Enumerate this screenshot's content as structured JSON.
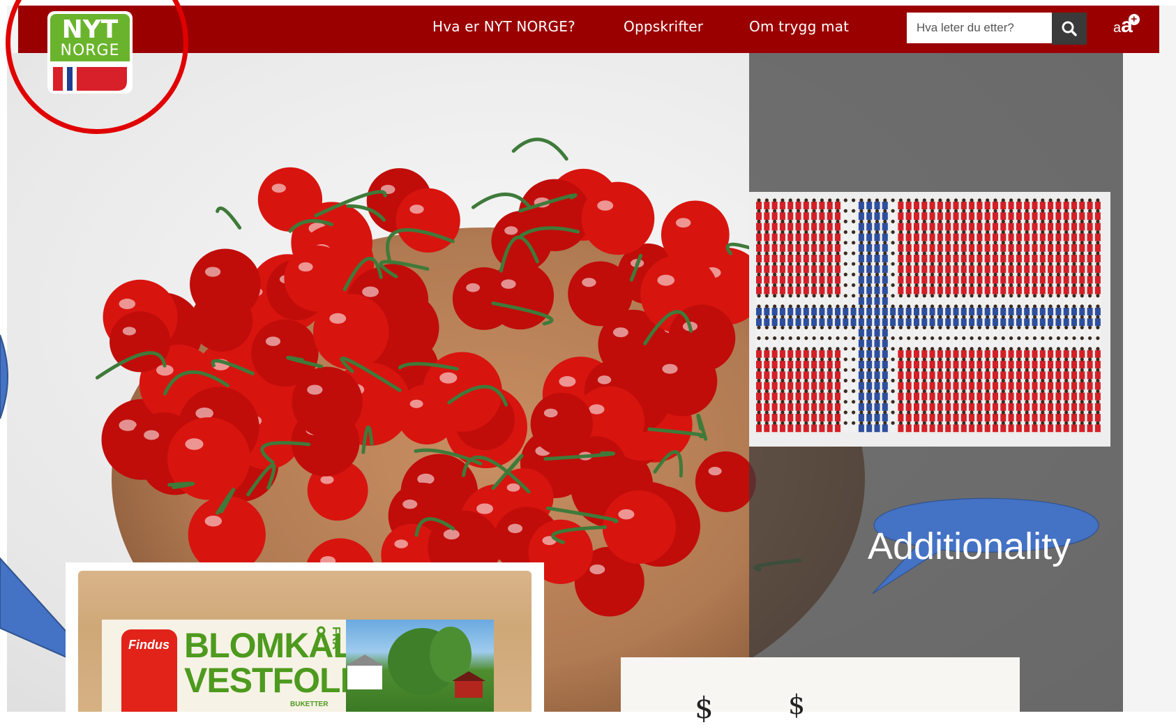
{
  "nav": {
    "links": [
      "Hva er NYT NORGE?",
      "Oppskrifter",
      "Om trygg mat"
    ],
    "search_placeholder": "Hva leter du etter?",
    "font_toggle_small": "a",
    "font_toggle_large": "a",
    "font_toggle_plus": "+"
  },
  "logo": {
    "line1": "NYT",
    "line2": "NORGE"
  },
  "product": {
    "brand": "Findus",
    "line1": "BLOMKÅL",
    "line2": "VESTFOLD",
    "fra": "FRA",
    "sub": "BUKETTER"
  },
  "callout": {
    "text": "Additionality"
  },
  "note": {
    "symbol1": "$",
    "symbol2": "$"
  },
  "colors": {
    "navbar": "#9b0000",
    "logo_green": "#6ab42d",
    "highlight_circle": "#e00000",
    "bubble_fill": "#4472c4",
    "bubble_stroke": "#2f528f"
  },
  "icons": {
    "search": "search-icon",
    "font_size": "font-size-plus-icon"
  }
}
